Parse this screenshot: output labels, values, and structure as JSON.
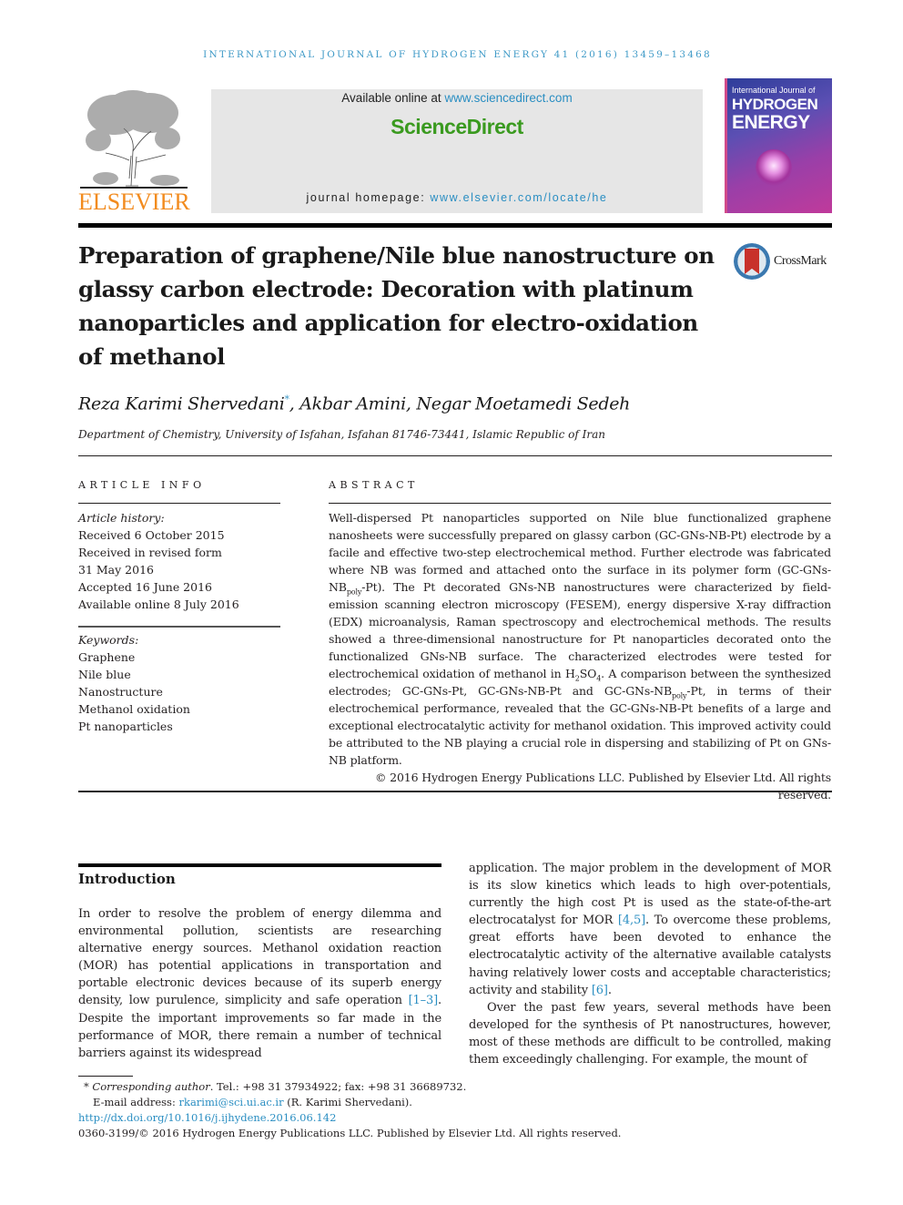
{
  "running_head": "INTERNATIONAL JOURNAL OF HYDROGEN ENERGY 41 (2016) 13459–13468",
  "publisher_logo": {
    "name": "ELSEVIER",
    "color": "#f28b1e"
  },
  "banner": {
    "available_prefix": "Available online at ",
    "available_link": "www.sciencedirect.com",
    "brand": "ScienceDirect",
    "brand_color": "#3a9a1f",
    "homepage_prefix": "journal homepage: ",
    "homepage_link": "www.elsevier.com/locate/he"
  },
  "cover": {
    "line1": "International Journal of",
    "line2": "HYDROGEN",
    "line3": "ENERGY"
  },
  "crossmark_label": "CrossMark",
  "article": {
    "title": "Preparation of graphene/Nile blue nanostructure on glassy carbon electrode: Decoration with platinum nanoparticles and application for electro-oxidation of methanol",
    "authors": [
      {
        "name": "Reza Karimi Shervedani",
        "mark": "*"
      },
      {
        "name": "Akbar Amini",
        "mark": ""
      },
      {
        "name": "Negar Moetamedi Sedeh",
        "mark": ""
      }
    ],
    "affiliation": "Department of Chemistry, University of Isfahan, Isfahan 81746-73441, Islamic Republic of Iran"
  },
  "article_info": {
    "label": "ARTICLE INFO",
    "history_label": "Article history:",
    "history": [
      "Received 6 October 2015",
      "Received in revised form",
      "31 May 2016",
      "Accepted 16 June 2016",
      "Available online 8 July 2016"
    ],
    "keywords_label": "Keywords:",
    "keywords": [
      "Graphene",
      "Nile blue",
      "Nanostructure",
      "Methanol oxidation",
      "Pt nanoparticles"
    ]
  },
  "abstract": {
    "label": "ABSTRACT",
    "p1": "Well-dispersed Pt nanoparticles supported on Nile blue functionalized graphene nanosheets were successfully prepared on glassy carbon (GC-GNs-NB-Pt) electrode by a facile and effective two-step electrochemical method. Further electrode was fabricated where NB was formed and attached onto the surface in its polymer form (GC-GNs-NB",
    "sub_poly": "poly",
    "p2": "-Pt). The Pt decorated GNs-NB nanostructures were characterized by field-emission scanning electron microscopy (FESEM), energy dispersive X-ray diffraction (EDX) microanalysis, Raman spectroscopy and electrochemical methods. The results showed a three-dimensional nanostructure for Pt nanoparticles decorated onto the functionalized GNs-NB surface. The characterized electrodes were tested for electrochemical oxidation of methanol in H",
    "sub_2": "2",
    "p3": "SO",
    "sub_4": "4",
    "p4": ". A comparison between the synthesized electrodes; GC-GNs-Pt, GC-GNs-NB-Pt and GC-GNs-NB",
    "p5": "-Pt, in terms of their electrochemical performance, revealed that the GC-GNs-NB-Pt benefits of a large and exceptional electrocatalytic activity for methanol oxidation. This improved activity could be attributed to the NB playing a crucial role in dispersing and stabilizing of Pt on GNs-NB platform.",
    "copyright": "© 2016 Hydrogen Energy Publications LLC. Published by Elsevier Ltd. All rights reserved."
  },
  "introduction": {
    "heading": "Introduction",
    "left_a": "In order to resolve the problem of energy dilemma and environmental pollution, scientists are researching alternative energy sources. Methanol oxidation reaction (MOR) has potential applications in transportation and portable electronic devices because of its superb energy density, low purulence, simplicity and safe operation ",
    "ref_1": "[1–3]",
    "left_b": ". Despite the important improvements so far made in the performance of MOR, there remain a number of technical barriers against its widespread",
    "right_a": "application. The major problem in the development of MOR is its slow kinetics which leads to high over-potentials, currently the high cost Pt is used as the state-of-the-art electrocatalyst for MOR ",
    "ref_2": "[4,5]",
    "right_b": ". To overcome these problems, great efforts have been devoted to enhance the electrocatalytic activity of the alternative available catalysts having relatively lower costs and acceptable characteristics; activity and stability ",
    "ref_3": "[6]",
    "right_c": ".",
    "right_p2": "Over the past few years, several methods have been developed for the synthesis of Pt nanostructures, however, most of these methods are difficult to be controlled, making them exceedingly challenging. For example, the mount of"
  },
  "footnotes": {
    "corr_mark": "* ",
    "corr_label": "Corresponding author",
    "corr_text": ". Tel.: +98 31 37934922; fax: +98 31 36689732.",
    "email_label": "E-mail address: ",
    "email": "rkarimi@sci.ui.ac.ir",
    "email_suffix": " (R. Karimi Shervedani).",
    "doi": "http://dx.doi.org/10.1016/j.ijhydene.2016.06.142",
    "issn_line": "0360-3199/© 2016 Hydrogen Energy Publications LLC. Published by Elsevier Ltd. All rights reserved."
  },
  "colors": {
    "link": "#2a8ec2",
    "running_head": "#3f9ac7"
  }
}
